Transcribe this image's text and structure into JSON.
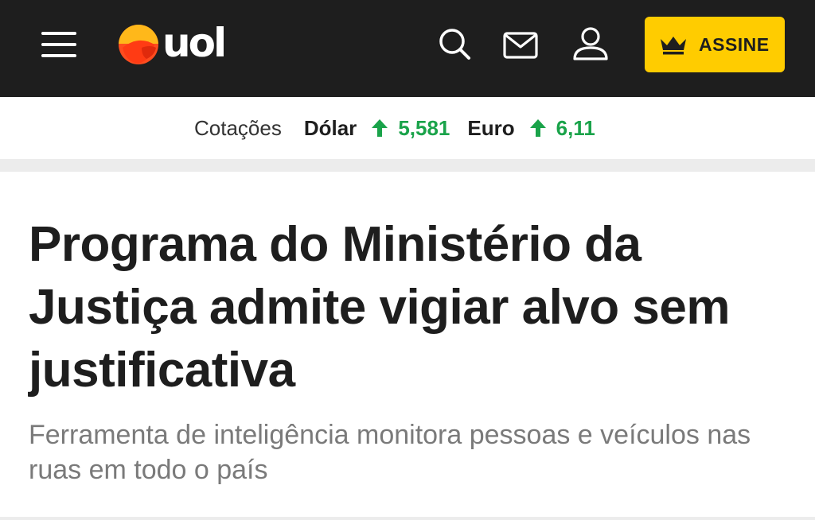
{
  "header": {
    "logo_text": "uol",
    "icons": {
      "menu": "hamburger-menu-icon",
      "search": "search-icon",
      "mail": "mail-icon",
      "user": "user-icon",
      "crown": "crown-icon"
    },
    "subscribe_label": "ASSINE",
    "colors": {
      "bar": "#1e1e1e",
      "subscribe": "#ffcc00"
    }
  },
  "quotes": {
    "title": "Cotações",
    "items": [
      {
        "name": "Dólar",
        "direction": "up",
        "value": "5,581"
      },
      {
        "name": "Euro",
        "direction": "up",
        "value": "6,11"
      }
    ],
    "up_color": "#1aa34a"
  },
  "article": {
    "headline": "Programa do Ministério da Justiça admite vigiar alvo sem justificativa",
    "subheadline": "Ferramenta de inteligência monitora pessoas e veículos nas ruas em todo o país"
  }
}
